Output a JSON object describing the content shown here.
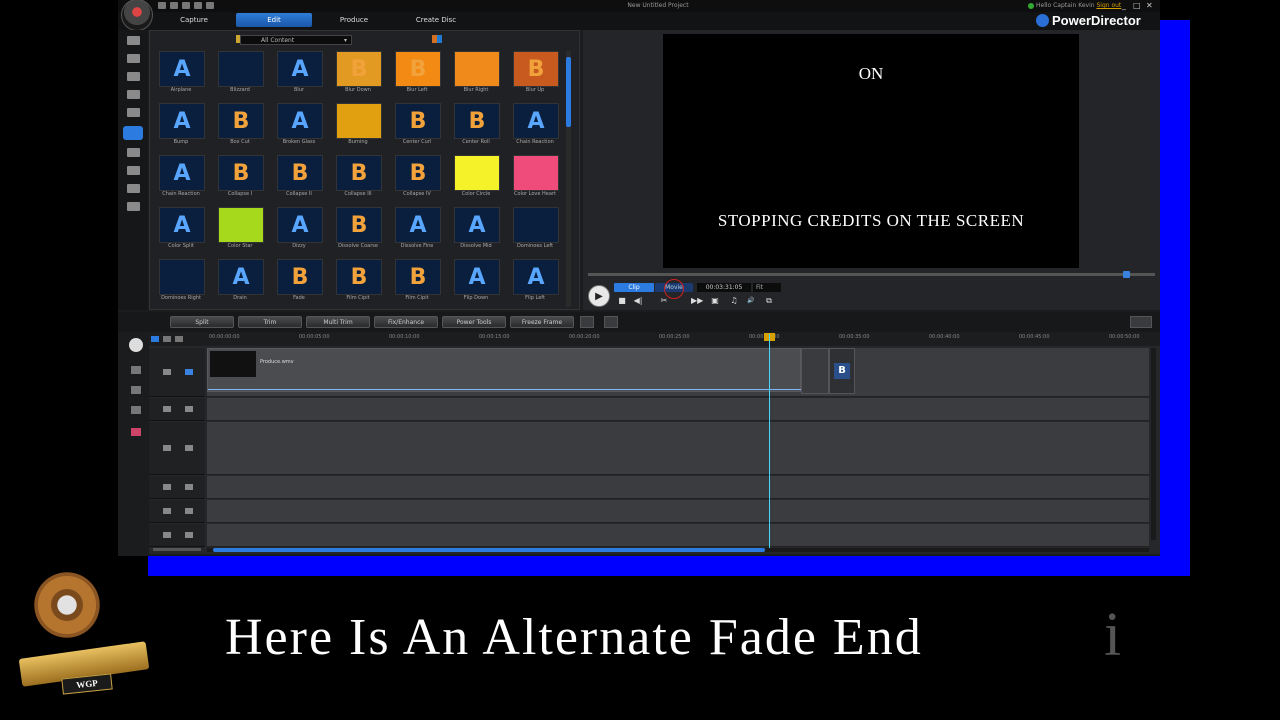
{
  "window": {
    "doc_title": "New Untitled Project",
    "user_text": "Hello Captain Kevin",
    "signout_text": "Sign out",
    "brand": "PowerDirector",
    "win_min": "_",
    "win_max": "□",
    "win_close": "✕"
  },
  "menu": {
    "tabs": [
      {
        "label": "Capture"
      },
      {
        "label": "Edit"
      },
      {
        "label": "Produce"
      },
      {
        "label": "Create Disc"
      }
    ]
  },
  "library": {
    "filter_value": "All Content",
    "items": [
      {
        "label": "Airplane",
        "glyph": "A"
      },
      {
        "label": "Blizzard",
        "glyph": ""
      },
      {
        "label": "Blur",
        "glyph": "A"
      },
      {
        "label": "Blur Down",
        "glyph": "B"
      },
      {
        "label": "Blur Left",
        "glyph": "B"
      },
      {
        "label": "Blur Right",
        "glyph": ""
      },
      {
        "label": "Blur Up",
        "glyph": "B"
      },
      {
        "label": "Bump",
        "glyph": "A"
      },
      {
        "label": "Box Cut",
        "glyph": "B"
      },
      {
        "label": "Broken Glass",
        "glyph": "A"
      },
      {
        "label": "Burning",
        "glyph": ""
      },
      {
        "label": "Center Curl",
        "glyph": "B"
      },
      {
        "label": "Center Roll",
        "glyph": "B"
      },
      {
        "label": "Chain Reaction",
        "glyph": "A"
      },
      {
        "label": "Chain Reaction",
        "glyph": "A"
      },
      {
        "label": "Collapse I",
        "glyph": "B"
      },
      {
        "label": "Collapse II",
        "glyph": "B"
      },
      {
        "label": "Collapse III",
        "glyph": "B"
      },
      {
        "label": "Collapse IV",
        "glyph": "B"
      },
      {
        "label": "Color Circle",
        "glyph": ""
      },
      {
        "label": "Color Love Heart",
        "glyph": ""
      },
      {
        "label": "Color Split",
        "glyph": "A"
      },
      {
        "label": "Color Star",
        "glyph": ""
      },
      {
        "label": "Dizzy",
        "glyph": "A"
      },
      {
        "label": "Dissolve Coarse",
        "glyph": "B"
      },
      {
        "label": "Dissolve Fine",
        "glyph": "A"
      },
      {
        "label": "Dissolve Mid",
        "glyph": "A"
      },
      {
        "label": "Dominoes Left",
        "glyph": ""
      },
      {
        "label": "Dominoes Right",
        "glyph": ""
      },
      {
        "label": "Drain",
        "glyph": "A"
      },
      {
        "label": "Fade",
        "glyph": "B"
      },
      {
        "label": "Film Cipit",
        "glyph": "B"
      },
      {
        "label": "Film Cipit",
        "glyph": "B"
      },
      {
        "label": "Flip Down",
        "glyph": "A"
      },
      {
        "label": "Flip Left",
        "glyph": "A"
      }
    ]
  },
  "preview": {
    "line_top": "ON",
    "line_bottom": "STOPPING  CREDITS  ON THE SCREEN",
    "mode_clip": "Clip",
    "mode_movie": "Movie",
    "timecode": "00:03:31:05",
    "quality": "Fit",
    "play_glyph": "▶",
    "stop_glyph": "■",
    "prev_glyph": "◀|",
    "split_glyph": "✂",
    "next_glyph": "▶▶",
    "snap_glyph": "▣",
    "audio_glyph": "♫",
    "vol_glyph": "🔊",
    "dock_glyph": "⧉"
  },
  "timeline_toolbar": {
    "buttons": [
      "Split",
      "Trim",
      "Multi Trim",
      "Fix/Enhance",
      "Power Tools",
      "Freeze Frame"
    ]
  },
  "timeline": {
    "ticks": [
      "00:00:00:00",
      "00:00:05:00",
      "00:00:10:00",
      "00:00:15:00",
      "00:00:20:00",
      "00:00:25:00",
      "00:00:30:00",
      "00:00:35:00",
      "00:00:40:00",
      "00:00:45:00",
      "00:00:50:00"
    ],
    "clip_label": "Produce.wmv",
    "clip_b_glyph": "B"
  },
  "overlay": {
    "caption": "Here Is An Alternate Fade End",
    "caption_tail": "i",
    "badge": "WGP"
  }
}
